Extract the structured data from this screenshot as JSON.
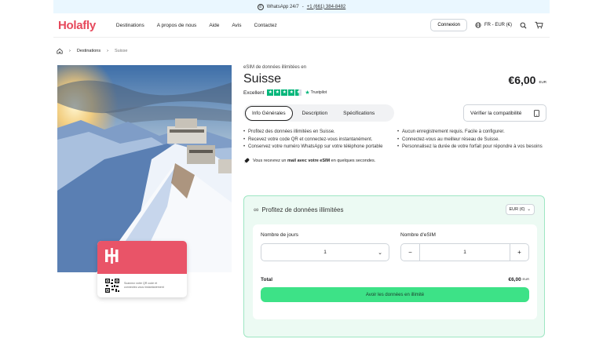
{
  "topbar": {
    "text": "WhatsApp 24/7",
    "phone": "+1 (661) 384-8482"
  },
  "nav": {
    "logo": "Holafly",
    "links": [
      "Destinations",
      "A propos de nous",
      "Aide",
      "Avis",
      "Contactez"
    ],
    "login": "Connexion",
    "lang": "FR - EUR (€)"
  },
  "breadcrumb": {
    "home": "home-icon",
    "destinations": "Destinations",
    "current": "Suisse"
  },
  "card": {
    "text1": "Scannez votre QR code et",
    "text2": "connectez-vous instantanément"
  },
  "product": {
    "kicker": "eSIM de données illimitées en",
    "title": "Suisse",
    "price": "€6,00",
    "currency": "EUR",
    "rating": "Excellent",
    "trustpilot": "Trustpilot",
    "rating_stars": 4.5
  },
  "tabs": [
    "Info Générales",
    "Description",
    "Spécifications"
  ],
  "verify": "Vérifier la compatibilité",
  "bullets_left": [
    "Profitez des données illimitées en Suisse.",
    "Recevez votre code QR et connectez-vous instantanément.",
    "Conservez votre numéro WhatsApp sur votre téléphone portable"
  ],
  "bullets_right": [
    "Aucun enregistrement requis. Facile à configurer.",
    "Connectez-vous au meilleur réseau de Suisse.",
    "Personnalisez la durée de votre forfait pour répondre à vos besoins"
  ],
  "note": {
    "before": "Vous recevrez un ",
    "bold": "mail avec votre eSIM",
    "after": " en quelques secondes."
  },
  "plan": {
    "title": "Profitez de données illimitées",
    "currency": "EUR (€)",
    "days_label": "Nombre de jours",
    "days_value": "1",
    "esim_label": "Nombre d'eSIM",
    "esim_value": "1",
    "total_label": "Total",
    "total_value": "€6,00",
    "total_currency": "EUR",
    "cta": "Avoir les données en illimité"
  },
  "colors": {
    "brand": "#e6495c",
    "cta": "#3de287",
    "trustpilot": "#00b67a",
    "plan_bg": "#ecfaf3"
  }
}
